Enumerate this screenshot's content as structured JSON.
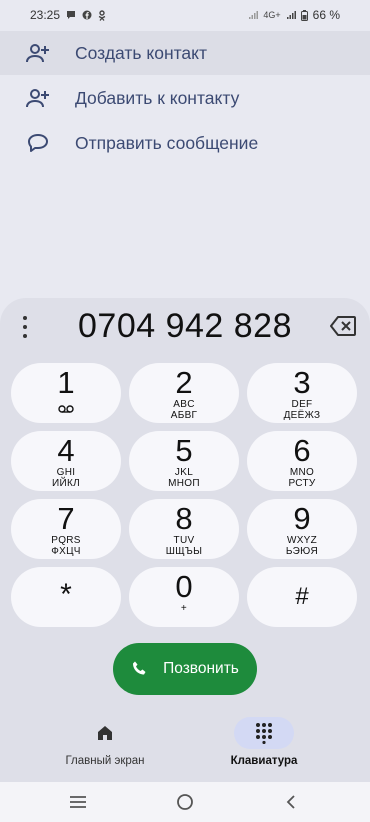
{
  "status": {
    "time": "23:25",
    "network": "4G+",
    "battery": "66 %"
  },
  "suggestions": [
    {
      "label": "Создать контакт",
      "icon": "add-person-icon"
    },
    {
      "label": "Добавить к контакту",
      "icon": "add-person-icon"
    },
    {
      "label": "Отправить сообщение",
      "icon": "message-bubble-icon"
    }
  ],
  "dialer": {
    "number": "0704 942 828"
  },
  "keys": [
    {
      "digit": "1",
      "l1": "",
      "l2": "",
      "icon": "voicemail-icon"
    },
    {
      "digit": "2",
      "l1": "ABC",
      "l2": "АБВГ"
    },
    {
      "digit": "3",
      "l1": "DEF",
      "l2": "ДЕЁЖЗ"
    },
    {
      "digit": "4",
      "l1": "GHI",
      "l2": "ИЙКЛ"
    },
    {
      "digit": "5",
      "l1": "JKL",
      "l2": "МНОП"
    },
    {
      "digit": "6",
      "l1": "MNO",
      "l2": "РСТУ"
    },
    {
      "digit": "7",
      "l1": "PQRS",
      "l2": "ФХЦЧ"
    },
    {
      "digit": "8",
      "l1": "TUV",
      "l2": "ШЩЪЫ"
    },
    {
      "digit": "9",
      "l1": "WXYZ",
      "l2": "ЬЭЮЯ"
    },
    {
      "digit": "*",
      "l1": "",
      "l2": ""
    },
    {
      "digit": "0",
      "l1": "+",
      "l2": ""
    },
    {
      "digit": "#",
      "l1": "",
      "l2": ""
    }
  ],
  "call": {
    "label": "Позвонить"
  },
  "nav": {
    "home_label": "Главный экран",
    "keypad_label": "Клавиатура"
  },
  "colors": {
    "call_green": "#1e8b3c",
    "accent_text": "#3c4a73",
    "selected_tab": "#d3d9f4"
  }
}
